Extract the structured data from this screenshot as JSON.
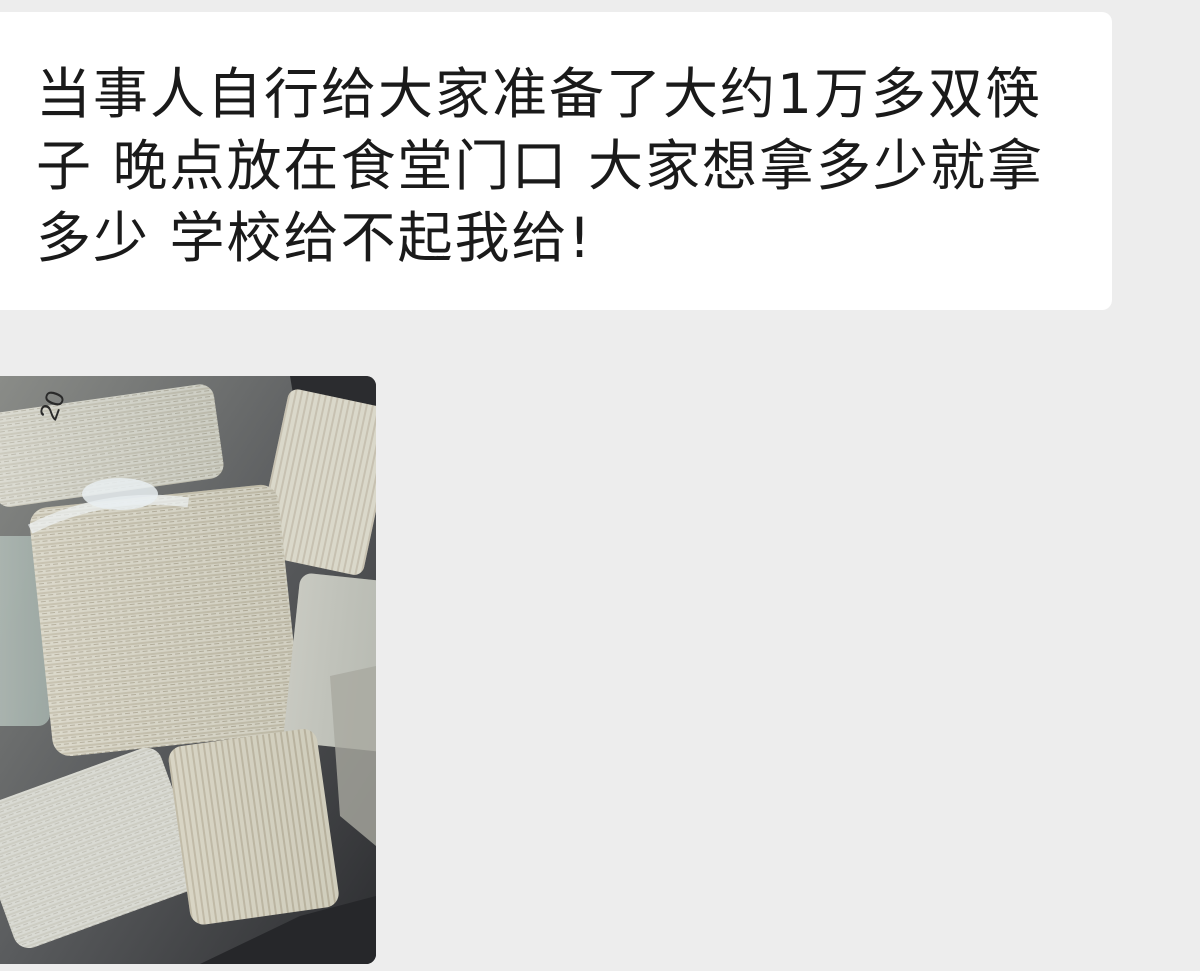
{
  "chat": {
    "message_text": "当事人自行给大家准备了大约1万多双筷子 晚点放在食堂门口 大家想拿多少就拿多少 学校给不起我给!",
    "photo": {
      "description_icon": "photo-bundled-chopsticks-icon",
      "handwritten_label": "20"
    }
  },
  "colors": {
    "background": "#ededed",
    "bubble": "#ffffff",
    "text": "#1a1a1a"
  }
}
